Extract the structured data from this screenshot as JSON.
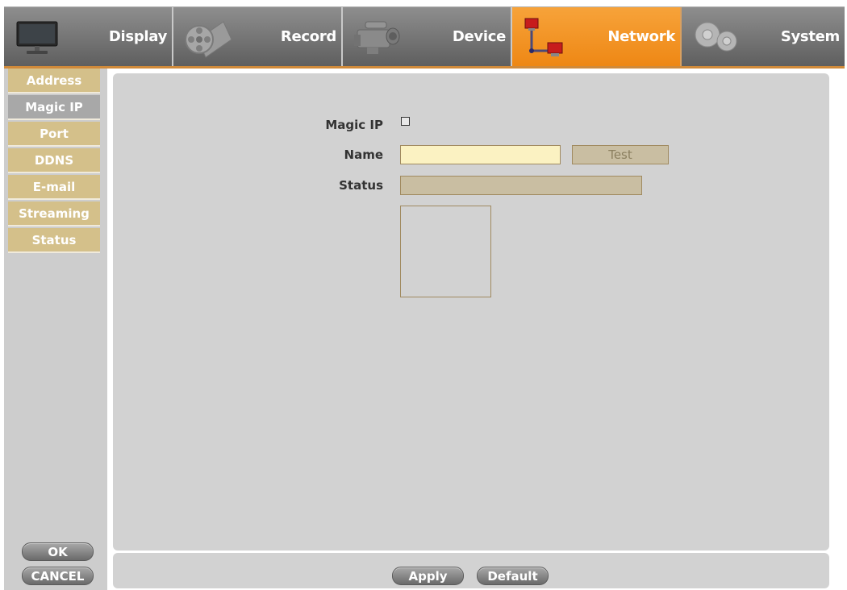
{
  "tabs": [
    {
      "label": "Display",
      "icon": "monitor-icon"
    },
    {
      "label": "Record",
      "icon": "film-reel-icon"
    },
    {
      "label": "Device",
      "icon": "camcorder-icon"
    },
    {
      "label": "Network",
      "icon": "network-icon",
      "active": true
    },
    {
      "label": "System",
      "icon": "gears-icon"
    }
  ],
  "sidebar": {
    "items": [
      {
        "label": "Address"
      },
      {
        "label": "Magic IP",
        "active": true
      },
      {
        "label": "Port"
      },
      {
        "label": "DDNS"
      },
      {
        "label": "E-mail"
      },
      {
        "label": "Streaming"
      },
      {
        "label": "Status"
      }
    ],
    "ok_label": "OK",
    "cancel_label": "CANCEL"
  },
  "form": {
    "magic_ip_label": "Magic IP",
    "magic_ip_checked": false,
    "name_label": "Name",
    "name_value": "",
    "test_label": "Test",
    "status_label": "Status",
    "status_value": ""
  },
  "footer": {
    "apply_label": "Apply",
    "default_label": "Default"
  },
  "colors": {
    "accent": "#f0901e",
    "menu_bg": "#d4c08a",
    "panel_bg": "#d2d2d2",
    "input_bg": "#fbf2c2"
  }
}
